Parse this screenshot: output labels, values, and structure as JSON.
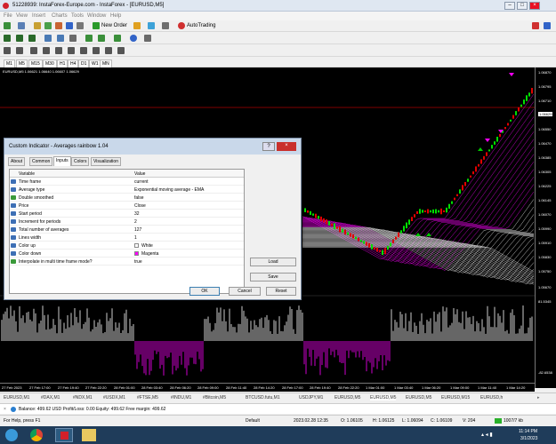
{
  "window": {
    "title": "51228939: InstaForex-Europe.com - InstaForex - [EURUSD,M5]"
  },
  "menu": [
    "File",
    "View",
    "Insert",
    "Charts",
    "Tools",
    "Window",
    "Help"
  ],
  "toolbar": {
    "new_order": "New Order",
    "autotrading": "AutoTrading"
  },
  "timeframes": [
    "M1",
    "M5",
    "M15",
    "M30",
    "H1",
    "H4",
    "D1",
    "W1",
    "MN"
  ],
  "chart": {
    "header": "EURUSD,M5  1.06621 1.06640 1.06607 1.06629",
    "current_price": "1.06629",
    "colors": {
      "up": "#00c800",
      "down": "#ff00ff",
      "background": "#000000"
    }
  },
  "price_axis": [
    "1.06870",
    "1.06795",
    "1.06710",
    "1.06629",
    "1.06550",
    "1.06470",
    "1.06385",
    "1.06305",
    "1.06225",
    "1.06145",
    "1.06070",
    "1.05990",
    "1.05910",
    "1.05830",
    "1.05750",
    "1.05670",
    "81.5345",
    "-82.6538"
  ],
  "time_axis": [
    "27 Feb 2023",
    "27 Feb 17:00",
    "27 Feb 19:40",
    "27 Feb 22:20",
    "28 Feb 01:00",
    "28 Feb 03:40",
    "28 Feb 06:20",
    "28 Feb 09:00",
    "28 Feb 11:40",
    "28 Feb 14:20",
    "28 Feb 17:00",
    "28 Feb 19:40",
    "28 Feb 22:20",
    "1 Mar 01:00",
    "1 Mar 03:40",
    "1 Mar 06:20",
    "1 Mar 09:00",
    "1 Mar 11:40",
    "1 Mar 14:20"
  ],
  "symbol_tabs": [
    "EURUSD,M1",
    "#DAX,M1",
    "#NDX,M1",
    "#USDX,M1",
    "#FTSE,M5",
    "#INDU,M1",
    "#Bitcoin,M5",
    "BTCUSD.futu,M1",
    "USDJPY,M1",
    "EURUSD,M5",
    "EURUSD,M5",
    "EURUSD,M5",
    "EURUSD,M15",
    "EURUSD,h"
  ],
  "dialog": {
    "title": "Custom Indicator - Averages rainbow 1.04",
    "tabs": [
      "About",
      "Common",
      "Inputs",
      "Colors",
      "Visualization"
    ],
    "columns": {
      "variable": "Variable",
      "value": "Value"
    },
    "rows": [
      {
        "name": "Time frame",
        "value": "current"
      },
      {
        "name": "Average type",
        "value": "Exponential moving average - EMA"
      },
      {
        "name": "Double smoothed",
        "value": "false"
      },
      {
        "name": "Price",
        "value": "Close"
      },
      {
        "name": "Start period",
        "value": "32"
      },
      {
        "name": "Increment for periods",
        "value": "2"
      },
      {
        "name": "Total number of averages",
        "value": "127"
      },
      {
        "name": "Lines width",
        "value": "1"
      },
      {
        "name": "Color up",
        "value": "White",
        "swatch": "#ffffff"
      },
      {
        "name": "Color down",
        "value": "Magenta",
        "swatch": "#ff00ff"
      },
      {
        "name": "Interpolate in multi time frame mode?",
        "value": "true"
      }
    ],
    "load": "Load",
    "save": "Save",
    "ok": "OK",
    "cancel": "Cancel",
    "reset": "Reset"
  },
  "balance_bar": "Balance: 499.62 USD  Profit/Loss: 0.00  Equity: 499.62  Free margin: 499.62",
  "status": {
    "help": "For Help, press F1",
    "profile": "Default",
    "datetime": "2023.02.28 12:35",
    "open": "O: 1.06105",
    "high": "H: 1.06125",
    "low": "L: 1.06094",
    "close": "C: 1.06109",
    "volume": "V: 204",
    "traffic": "1007/7 kb"
  },
  "tray": {
    "time": "11:14 PM",
    "date": "3/1/2023"
  }
}
